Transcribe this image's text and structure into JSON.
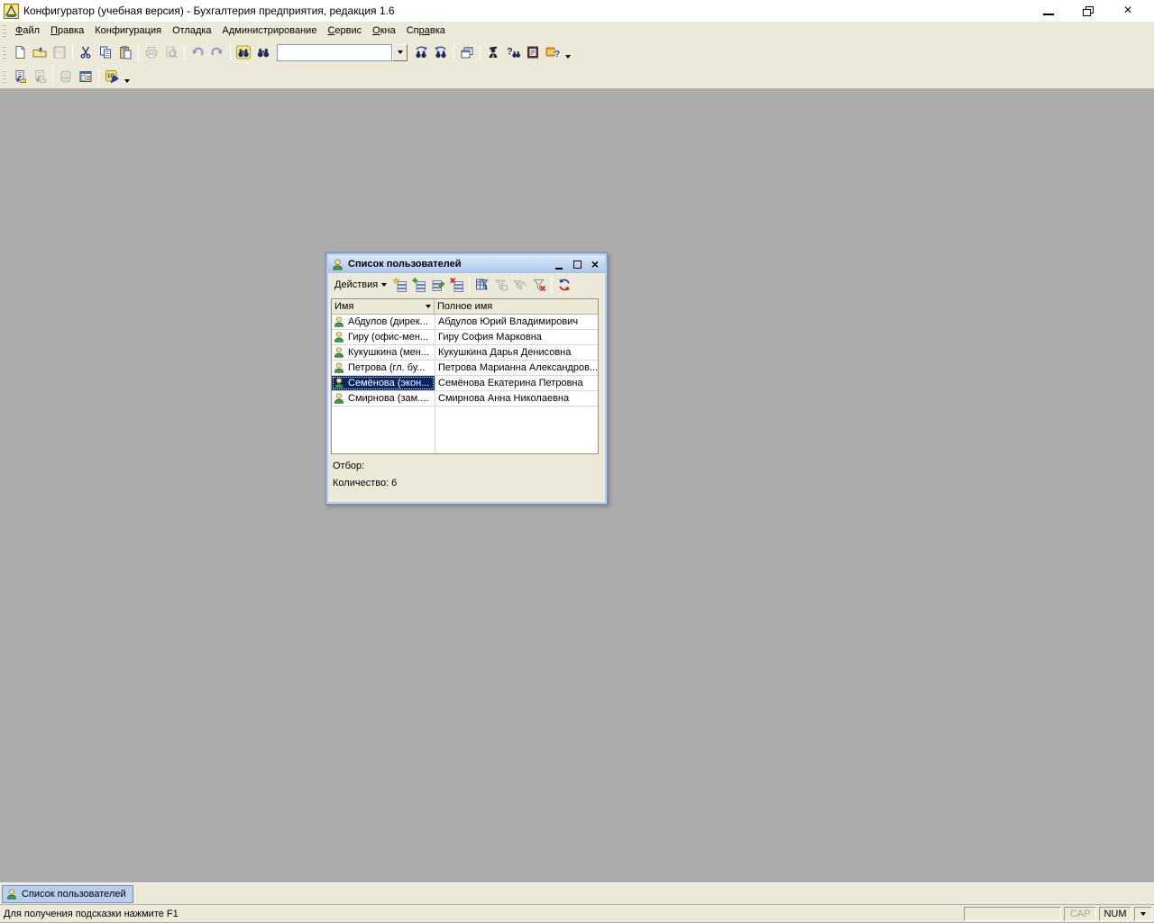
{
  "app": {
    "title": "Конфигуратор (учебная версия) - Бухгалтерия предприятия, редакция 1.6"
  },
  "menu": {
    "items": [
      {
        "pre": "",
        "accel": "Ф",
        "post": "айл"
      },
      {
        "pre": "",
        "accel": "П",
        "post": "равка"
      },
      {
        "pre": "Конфигурация",
        "accel": "",
        "post": ""
      },
      {
        "pre": "Отладка",
        "accel": "",
        "post": ""
      },
      {
        "pre": "Администрирование",
        "accel": "",
        "post": ""
      },
      {
        "pre": "",
        "accel": "С",
        "post": "ервис"
      },
      {
        "pre": "",
        "accel": "О",
        "post": "кна"
      },
      {
        "pre": "Сп",
        "accel": "ра",
        "post": "вка"
      }
    ]
  },
  "toolbar_main": {
    "search_value": "",
    "icons_row1": [
      "new-document",
      "open",
      "save",
      "cut",
      "copy",
      "paste",
      "print",
      "print-preview",
      "undo",
      "redo",
      "global-search",
      "find",
      "search-combobox",
      "find-next",
      "find-previous",
      "windows-cascade",
      "syntax-helper",
      "help-search",
      "help-contents",
      "about-1c-help",
      "toolbar-overflow"
    ],
    "icons_row2": [
      "open-configuration",
      "save-configuration",
      "update-db-configuration",
      "configuration-window",
      "start-1c-enterprise",
      "toolbar-overflow"
    ]
  },
  "user_list": {
    "title": "Список пользователей",
    "actions_label": "Действия",
    "toolbar_icons": [
      "add",
      "copy-item",
      "edit",
      "delete",
      "set-filter-sort",
      "filter-by-value",
      "filter-history",
      "clear-filter",
      "refresh"
    ],
    "columns": [
      {
        "label": "Имя"
      },
      {
        "label": "Полное имя"
      }
    ],
    "rows": [
      {
        "name": "Абдулов (дирек...",
        "full_name": "Абдулов Юрий Владимирович"
      },
      {
        "name": "Гиру (офис-мен...",
        "full_name": "Гиру София Марковна"
      },
      {
        "name": "Кукушкина (мен...",
        "full_name": "Кукушкина Дарья Денисовна"
      },
      {
        "name": "Петрова (гл. бу...",
        "full_name": "Петрова Марианна Александров..."
      },
      {
        "name": "Семёнова (экон...",
        "full_name": "Семёнова Екатерина Петровна"
      },
      {
        "name": "Смирнова (зам....",
        "full_name": "Смирнова Анна Николаевна"
      }
    ],
    "selected_row_index": 4,
    "filter_label": "Отбор:",
    "count_label": "Количество: 6"
  },
  "taskbar": {
    "buttons": [
      {
        "label": "Список пользователей",
        "active": true
      }
    ]
  },
  "status": {
    "hint": "Для получения подсказки нажмите F1",
    "cap": "CAP",
    "num": "NUM"
  },
  "glyphs": {
    "close": "×",
    "one_c": "1С",
    "question": "?"
  },
  "colors": {
    "chrome": "#ece9d8",
    "desktop": "#ababab",
    "selection": "#0a246a",
    "child_border": "#6f8fc4",
    "child_title_top": "#dde9fb",
    "child_title_bottom": "#a9c4e9",
    "taskbar_button": "#b9cfec"
  }
}
